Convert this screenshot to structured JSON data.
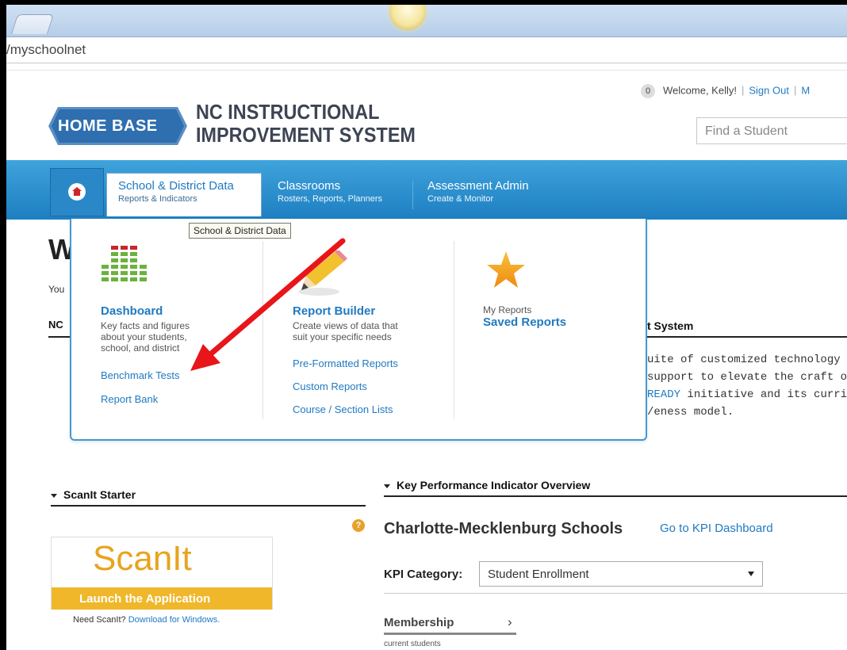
{
  "browser": {
    "address": "/myschoolnet"
  },
  "header": {
    "logo_text": "HOME BASE",
    "site_title_line1": "NC INSTRUCTIONAL",
    "site_title_line2": "IMPROVEMENT SYSTEM",
    "notification_count": "0",
    "welcome": "Welcome, Kelly!",
    "sign_out": "Sign Out",
    "more_link": "M",
    "search_placeholder": "Find a Student"
  },
  "nav": {
    "items": [
      {
        "title": "School & District Data",
        "subtitle": "Reports & Indicators"
      },
      {
        "title": "Classrooms",
        "subtitle": "Rosters, Reports, Planners"
      },
      {
        "title": "Assessment Admin",
        "subtitle": "Create & Monitor"
      }
    ],
    "tooltip": "School & District Data"
  },
  "dropdown": {
    "col1": {
      "heading": "Dashboard",
      "desc_lines": [
        "Key facts and figures",
        "about your students,",
        "school, and district"
      ],
      "links": [
        "Benchmark Tests",
        "Report Bank"
      ],
      "icon": "bar-chart-icon"
    },
    "col2": {
      "heading": "Report Builder",
      "desc_lines": [
        "Create views of data that",
        "suit your specific needs"
      ],
      "links": [
        "Pre-Formatted Reports",
        "Custom Reports",
        "Course / Section Lists"
      ],
      "icon": "pencil-icon"
    },
    "col3": {
      "label": "My Reports",
      "heading": "Saved Reports",
      "icon": "star-icon"
    }
  },
  "page": {
    "heading_partial": "W",
    "you_partial": "You",
    "nc_partial": "NC",
    "system_partial": "t System",
    "desc_lines": [
      "uite of customized technology to",
      " support to elevate the craft of e",
      " READY initiative and its curricul",
      "/eness model."
    ],
    "desc_link": "READY"
  },
  "scanit": {
    "section_title": "ScanIt Starter",
    "logo_word": "ScanIt",
    "launch": "Launch the Application",
    "need": "Need ScanIt?",
    "download": "Download for Windows."
  },
  "kpi": {
    "section_title": "Key Performance Indicator Overview",
    "district": "Charlotte-Mecklenburg Schools",
    "dashboard_link": "Go to KPI Dashboard",
    "category_label": "KPI Category:",
    "category_value": "Student Enrollment",
    "membership": "Membership",
    "membership_sub": "current students"
  },
  "colors": {
    "nav_blue": "#1d7fc1",
    "link_blue": "#1f7ac2",
    "scanit_gold": "#f0b72a",
    "annotation_arrow": "#e8161a"
  }
}
